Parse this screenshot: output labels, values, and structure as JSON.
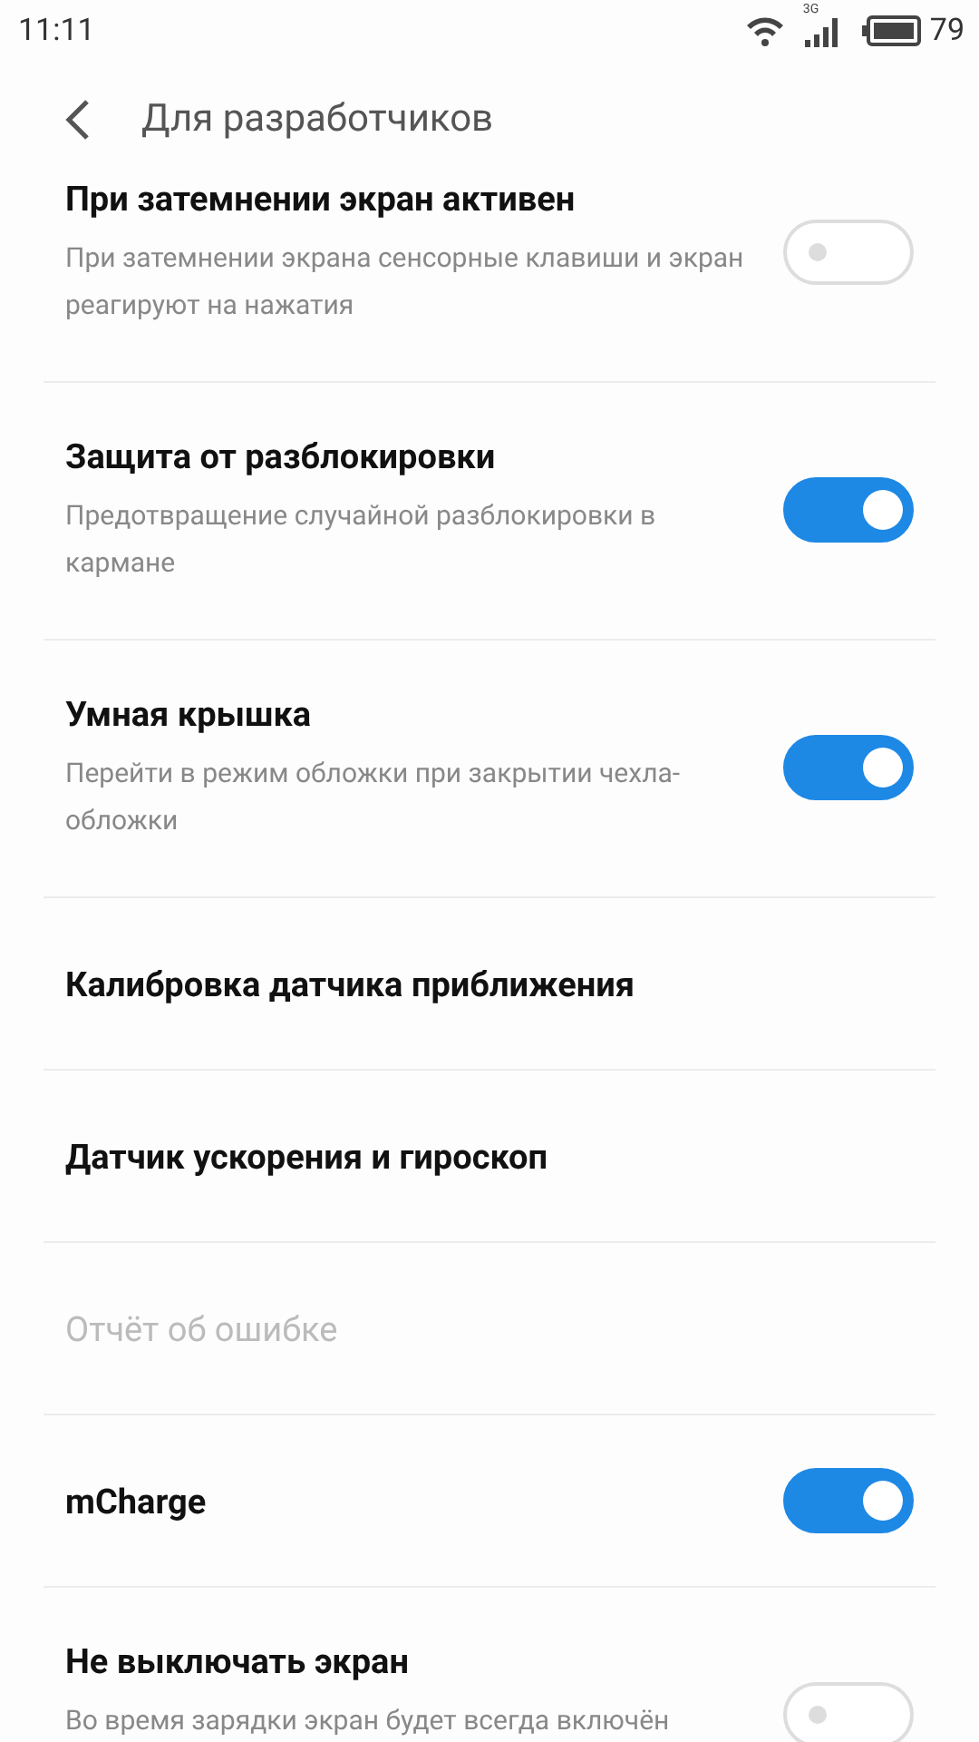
{
  "status_bar": {
    "time": "11:11",
    "network": "3G",
    "battery": "79"
  },
  "header": {
    "title": "Для разработчиков"
  },
  "settings": [
    {
      "kind": "switch",
      "title": "При затемнении экран активен",
      "subtitle": "При затемнении экрана сенсорные клавиши и экран реагируют на нажатия",
      "on": false,
      "disabled": false
    },
    {
      "kind": "switch",
      "title": "Защита от разблокировки",
      "subtitle": "Предотвращение случайной разблокировки в кармане",
      "on": true,
      "disabled": false
    },
    {
      "kind": "switch",
      "title": "Умная крышка",
      "subtitle": "Перейти в режим обложки при закрытии чехла-обложки",
      "on": true,
      "disabled": false
    },
    {
      "kind": "link",
      "title": "Калибровка датчика приближения",
      "disabled": false
    },
    {
      "kind": "link",
      "title": "Датчик ускорения и гироскоп",
      "disabled": false
    },
    {
      "kind": "link",
      "title": "Отчёт об ошибке",
      "disabled": true
    },
    {
      "kind": "switch",
      "title": "mCharge",
      "on": true,
      "disabled": false
    },
    {
      "kind": "switch",
      "title": "Не выключать экран",
      "subtitle": "Во время зарядки экран будет всегда включён",
      "on": false,
      "disabled": false
    }
  ]
}
